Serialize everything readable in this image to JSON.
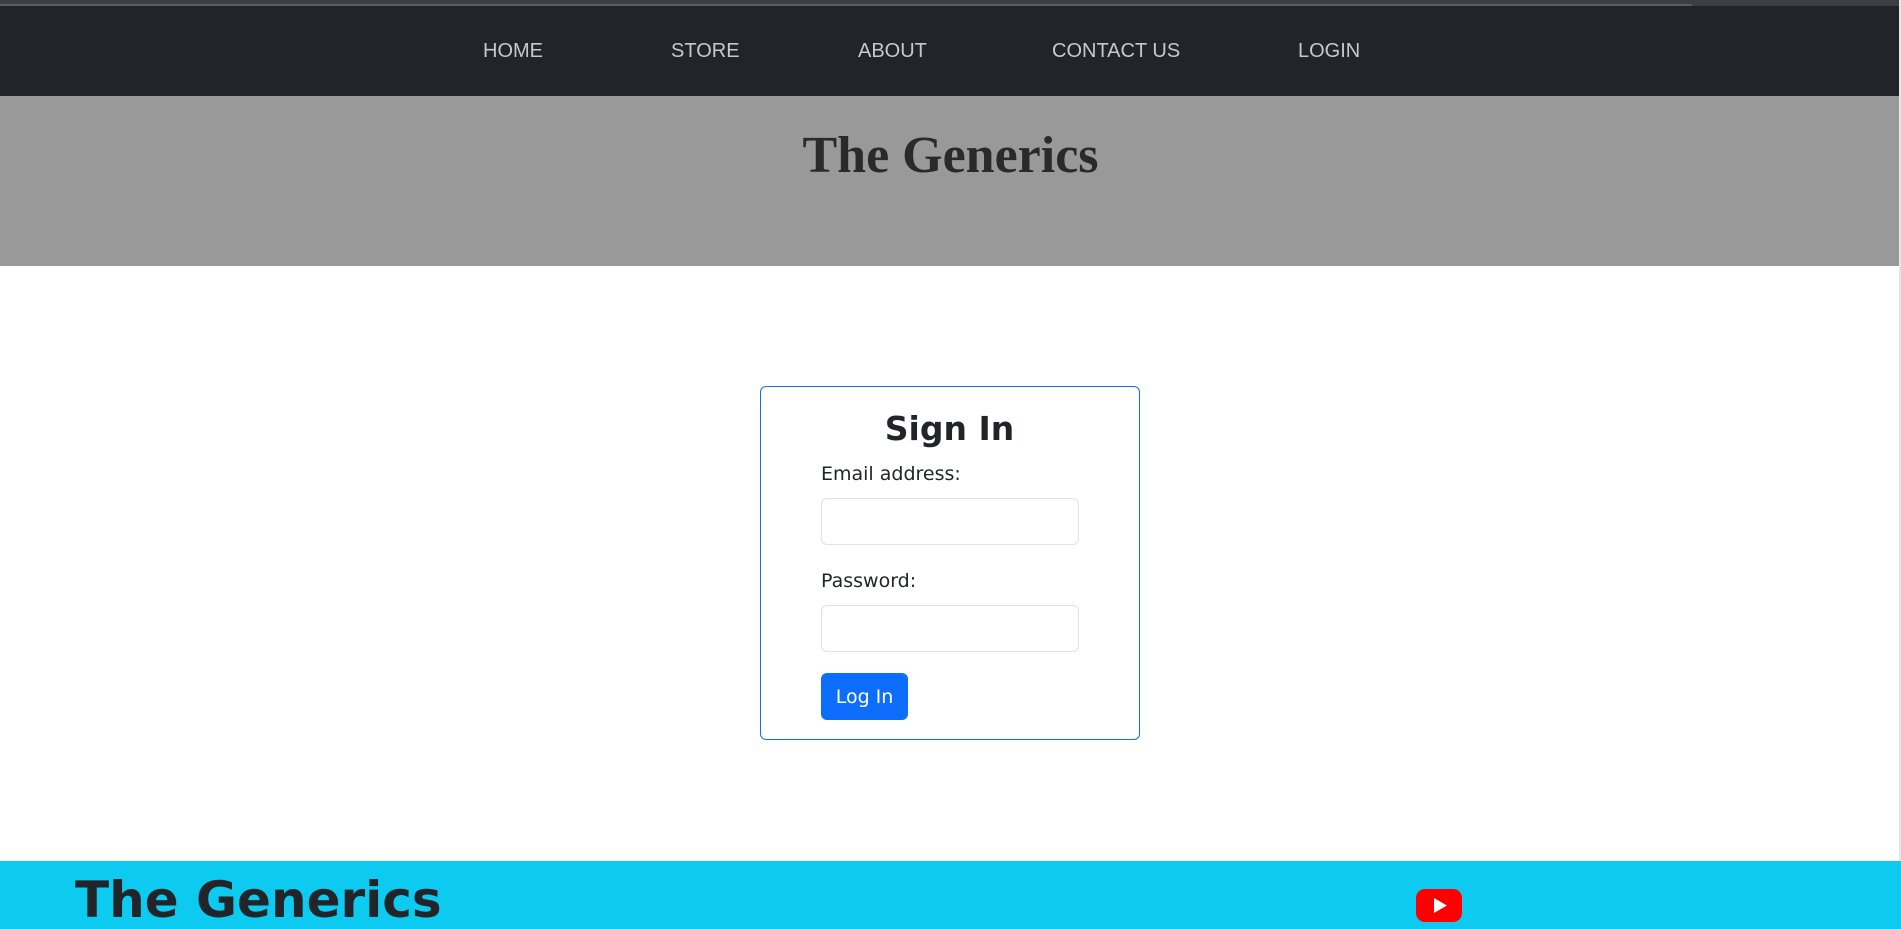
{
  "nav": {
    "items": [
      {
        "label": "HOME"
      },
      {
        "label": "STORE"
      },
      {
        "label": "ABOUT"
      },
      {
        "label": "CONTACT US"
      },
      {
        "label": "LOGIN"
      }
    ]
  },
  "hero": {
    "title": "The Generics"
  },
  "signin": {
    "title": "Sign In",
    "email_label": "Email address:",
    "email_value": "",
    "password_label": "Password:",
    "password_value": "",
    "submit_label": "Log In"
  },
  "footer": {
    "title": "The Generics",
    "icon": "youtube-icon"
  },
  "colors": {
    "navbar": "#212529",
    "hero": "#999999",
    "primary": "#0d6efd",
    "footer": "#0dcaf0",
    "youtube": "#ff0000"
  }
}
